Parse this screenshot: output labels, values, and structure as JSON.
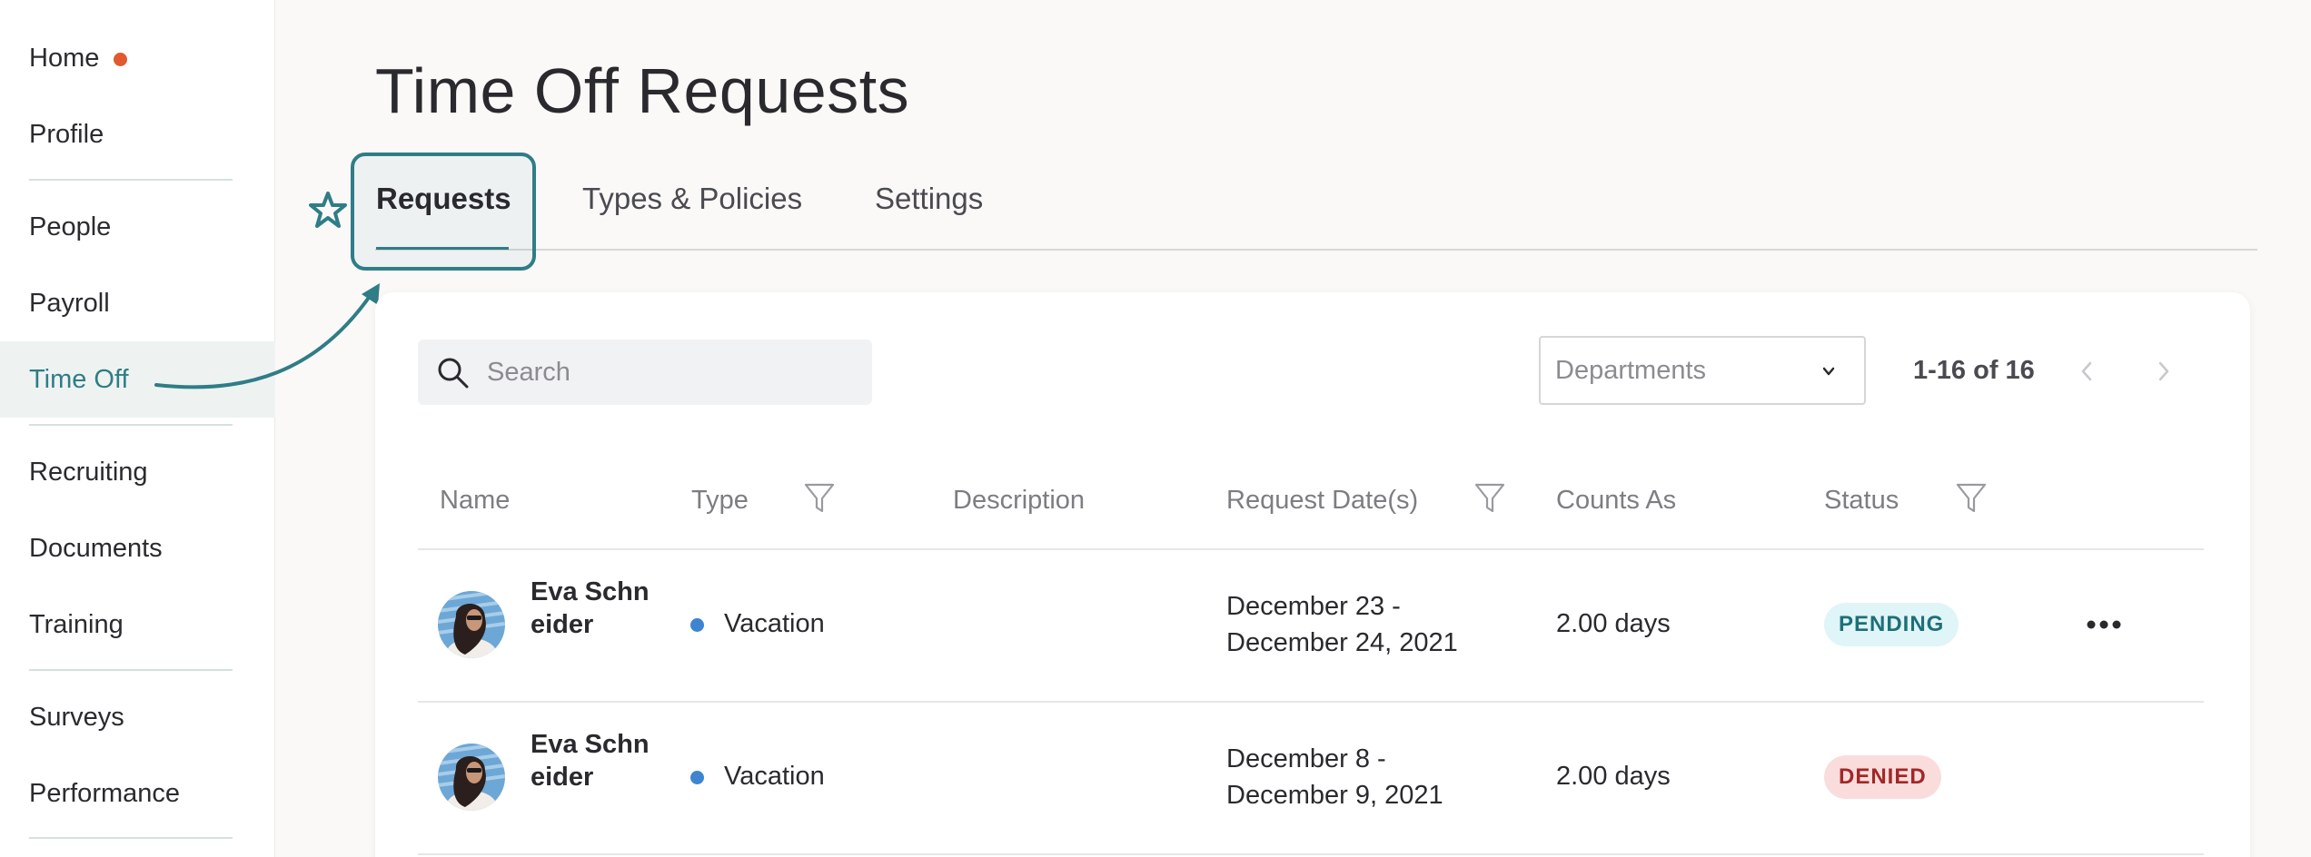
{
  "sidebar": {
    "items": [
      {
        "label": "Home",
        "notification": true
      },
      {
        "label": "Profile"
      },
      {
        "label": "People"
      },
      {
        "label": "Payroll"
      },
      {
        "label": "Time Off",
        "active": true
      },
      {
        "label": "Recruiting"
      },
      {
        "label": "Documents"
      },
      {
        "label": "Training"
      },
      {
        "label": "Surveys"
      },
      {
        "label": "Performance"
      }
    ]
  },
  "page": {
    "title": "Time Off Requests"
  },
  "tabs": [
    {
      "label": "Requests",
      "active": true
    },
    {
      "label": "Types & Policies"
    },
    {
      "label": "Settings"
    }
  ],
  "toolbar": {
    "search_placeholder": "Search",
    "departments_placeholder": "Departments",
    "pagination": "1-16 of 16"
  },
  "table": {
    "columns": [
      "Name",
      "Type",
      "Description",
      "Request Date(s)",
      "Counts As",
      "Status"
    ],
    "rows": [
      {
        "name": "Eva Schneider",
        "type": "Vacation",
        "description": "",
        "date_line1": "December 23 -",
        "date_line2": "December 24, 2021",
        "counts_as": "2.00 days",
        "status": "PENDING"
      },
      {
        "name": "Eva Schneider",
        "type": "Vacation",
        "description": "",
        "date_line1": "December 8 -",
        "date_line2": "December 9, 2021",
        "counts_as": "2.00 days",
        "status": "DENIED"
      }
    ]
  },
  "colors": {
    "accent": "#2f7d86",
    "notification": "#e0592f",
    "vacation": "#3d85d0"
  }
}
